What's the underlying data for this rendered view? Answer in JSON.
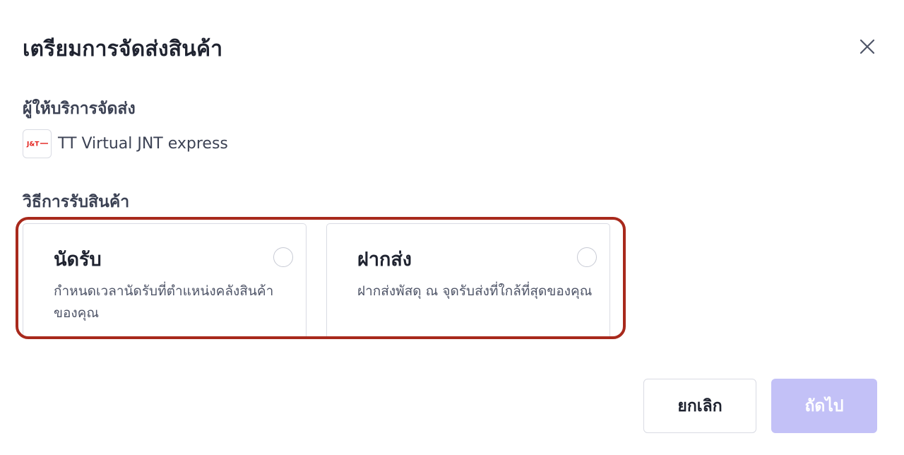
{
  "modal": {
    "title": "เตรียมการจัดส่งสินค้า"
  },
  "carrier": {
    "label": "ผู้ให้บริการจัดส่ง",
    "logo_text": "J&T",
    "name": "TT Virtual JNT express"
  },
  "pickup_method": {
    "label": "วิธีการรับสินค้า",
    "options": [
      {
        "title": "นัดรับ",
        "description": "กำหนดเวลานัดรับที่ตำแหน่งคลังสินค้าของคุณ",
        "selected": false
      },
      {
        "title": "ฝากส่ง",
        "description": "ฝากส่งพัสดุ ณ จุดรับส่งที่ใกล้ที่สุดของคุณ",
        "selected": false
      }
    ]
  },
  "footer": {
    "cancel_label": "ยกเลิก",
    "next_label": "ถัดไป"
  },
  "colors": {
    "highlight": "#a8291c",
    "next_disabled": "#c3c1f7",
    "logo_red": "#e3211c"
  }
}
